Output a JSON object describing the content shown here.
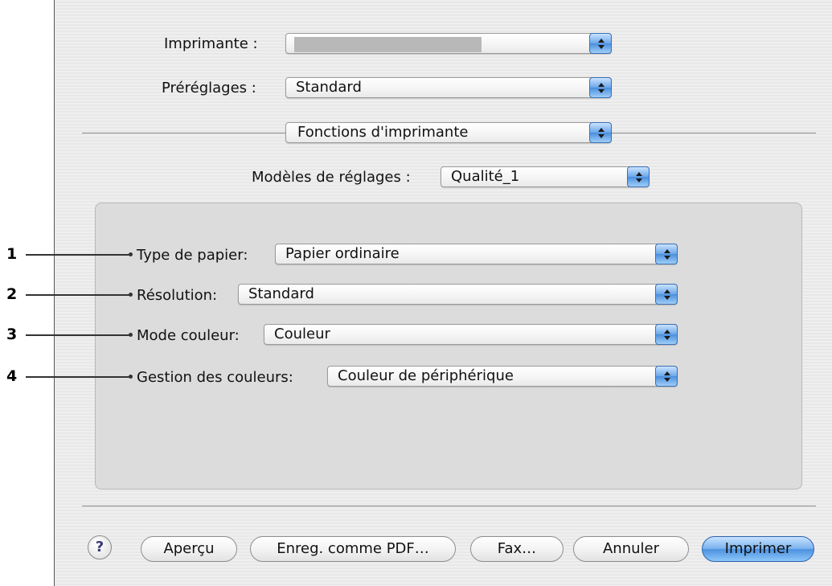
{
  "dialog": {
    "printer_label": "Imprimante :",
    "printer_value": "",
    "presets_label": "Préréglages :",
    "presets_value": "Standard",
    "section_value": "Fonctions d'imprimante",
    "templates_label": "Modèles de réglages :",
    "templates_value": "Qualité_1"
  },
  "panel": {
    "rows": [
      {
        "label": "Type de papier:",
        "value": "Papier ordinaire"
      },
      {
        "label": "Résolution:",
        "value": "Standard"
      },
      {
        "label": "Mode couleur:",
        "value": "Couleur"
      },
      {
        "label": "Gestion des couleurs:",
        "value": "Couleur de périphérique"
      }
    ]
  },
  "callouts": [
    "1",
    "2",
    "3",
    "4"
  ],
  "buttons": {
    "help": "?",
    "preview": "Aperçu",
    "save_pdf": "Enreg. comme PDF…",
    "fax": "Fax…",
    "cancel": "Annuler",
    "print": "Imprimer"
  }
}
